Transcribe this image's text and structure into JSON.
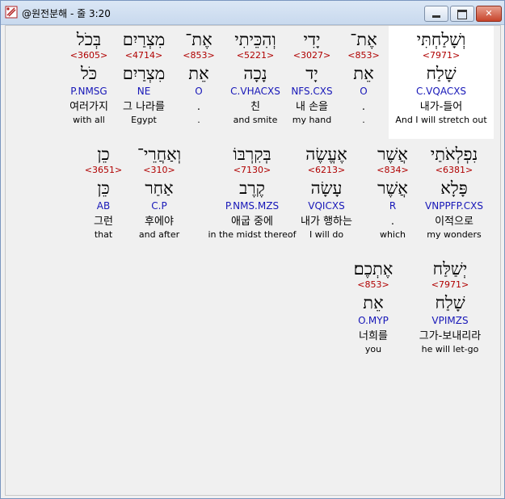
{
  "window": {
    "title": "@원전분해 - 줄 3:20",
    "controls": {
      "minimize": "minimize",
      "maximize": "maximize",
      "close": "✕"
    }
  },
  "lines": [
    {
      "words": [
        {
          "heb": "וְשָׁלַחְתִּי",
          "num": "<7971>",
          "lex": "שָׁלַח",
          "parse": "C.VQACXS",
          "kor": "내가-들어",
          "eng": "And I will stretch out",
          "selected": true
        },
        {
          "heb": "אֶת־",
          "num": "<853>",
          "lex": "אֵת",
          "parse": "O",
          "kor": ".",
          "eng": "."
        },
        {
          "heb": "יָדִי",
          "num": "<3027>",
          "lex": "יָד",
          "parse": "NFS.CXS",
          "kor": "내 손을",
          "eng": "my hand"
        },
        {
          "heb": "וְהִכֵּיתִי",
          "num": "<5221>",
          "lex": "נָכָה",
          "parse": "C.VHACXS",
          "kor": "친",
          "eng": "and smite"
        },
        {
          "heb": "אֶת־",
          "num": "<853>",
          "lex": "אֵת",
          "parse": "O",
          "kor": ".",
          "eng": "."
        },
        {
          "heb": "מִצְרַיִם",
          "num": "<4714>",
          "lex": "מִצְרַיִם",
          "parse": "NE",
          "kor": "그 나라를",
          "eng": "Egypt"
        },
        {
          "heb": "בְּכֹל",
          "num": "<3605>",
          "lex": "כֹּל",
          "parse": "P.NMSG",
          "kor": "여러가지",
          "eng": "with all"
        }
      ]
    },
    {
      "words": [
        {
          "heb": "נִפְלְאֹתַי",
          "num": "<6381>",
          "lex": "פָּלָא",
          "parse": "VNPPFP.CXS",
          "kor": "이적으로",
          "eng": "my wonders"
        },
        {
          "heb": "אֲשֶׁר",
          "num": "<834>",
          "lex": "אֲשֶׁר",
          "parse": "R",
          "kor": ".",
          "eng": "which"
        },
        {
          "heb": "אֶעֱשֶׂה",
          "num": "<6213>",
          "lex": "עָשָׂה",
          "parse": "VQICXS",
          "kor": "내가 행하는",
          "eng": "I will do"
        },
        {
          "heb": "בְּקִרְבּוֹ",
          "num": "<7130>",
          "lex": "קֶרֶב",
          "parse": "P.NMS.MZS",
          "kor": "애굽 중에",
          "eng": "in the midst thereof"
        },
        {
          "heb": "וְאַחֲרֵי־",
          "num": "<310>",
          "lex": "אַחַר",
          "parse": "C.P",
          "kor": "후에야",
          "eng": "and after"
        },
        {
          "heb": "כֵן",
          "num": "<3651>",
          "lex": "כֵּן",
          "parse": "AB",
          "kor": "그런",
          "eng": "that"
        }
      ]
    },
    {
      "words": [
        {
          "heb": "יְשַׁלַּח",
          "num": "<7971>",
          "lex": "שָׁלַח",
          "parse": "VPIMZS",
          "kor": "그가-보내리라",
          "eng": "he will let-go"
        },
        {
          "heb": "אֶתְכֶם׃",
          "num": "<853>",
          "lex": "אֵת",
          "parse": "O.MYP",
          "kor": "너희를",
          "eng": "you"
        }
      ]
    }
  ],
  "colors": {
    "strong_number": "#b00000",
    "parse_code": "#1717b8",
    "selection_bg": "#ffffff",
    "background": "#f0f0f0"
  },
  "icons": {
    "app": "parchment-scroll-icon"
  }
}
